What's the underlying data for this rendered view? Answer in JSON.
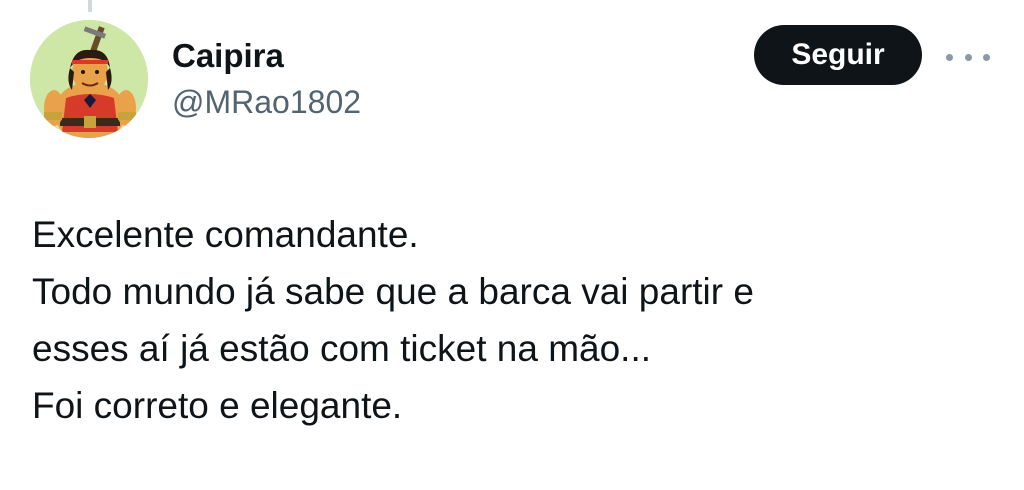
{
  "tweet": {
    "author": {
      "display_name": "Caipira",
      "handle": "@MRao1802",
      "avatar_icon": "cartoon-barbarian-avatar"
    },
    "follow_label": "Seguir",
    "more_icon": "more-horizontal-icon",
    "text_lines": [
      "Excelente comandante.",
      "Todo mundo já sabe que a barca vai partir e",
      "esses aí já estão com ticket na mão...",
      "Foi correto e elegante."
    ]
  },
  "colors": {
    "button_bg": "#0f1419",
    "button_text": "#ffffff",
    "handle": "#536471",
    "text": "#0f1419"
  }
}
